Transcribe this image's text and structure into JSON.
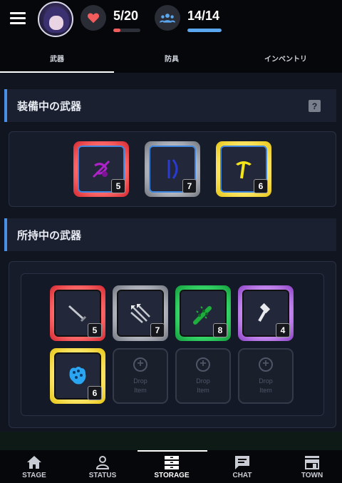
{
  "header": {
    "hp": {
      "text": "5/20",
      "fraction": 0.25,
      "color": "#f25c5c"
    },
    "team": {
      "text": "14/14",
      "fraction": 1.0,
      "color": "#5aa7ef"
    }
  },
  "tabs": [
    {
      "label": "武器",
      "active": true
    },
    {
      "label": "防具",
      "active": false
    },
    {
      "label": "インベントリ",
      "active": false
    }
  ],
  "equipped_section": {
    "title": "装備中の武器",
    "help": "?",
    "slots": [
      {
        "icon": "crossbow-icon",
        "rarity": "red",
        "level": "5"
      },
      {
        "icon": "bow-icon",
        "rarity": "silver",
        "level": "7"
      },
      {
        "icon": "pickaxe-icon",
        "rarity": "yellow",
        "level": "6"
      }
    ]
  },
  "owned_section": {
    "title": "所持中の武器",
    "items": [
      {
        "icon": "dagger-icon",
        "rarity": "red",
        "level": "5"
      },
      {
        "icon": "arrows-icon",
        "rarity": "silver",
        "level": "7"
      },
      {
        "icon": "spiked-club-icon",
        "rarity": "green",
        "level": "8"
      },
      {
        "icon": "hammer-icon",
        "rarity": "purple",
        "level": "4"
      },
      {
        "icon": "gauntlet-icon",
        "rarity": "yellow",
        "level": "6"
      }
    ],
    "empty_slot": {
      "line1": "Drop",
      "line2": "Item"
    }
  },
  "bottom_nav": [
    {
      "label": "STAGE",
      "icon": "home-icon"
    },
    {
      "label": "STATUS",
      "icon": "person-icon"
    },
    {
      "label": "STORAGE",
      "icon": "storage-icon",
      "active": true
    },
    {
      "label": "CHAT",
      "icon": "chat-icon"
    },
    {
      "label": "TOWN",
      "icon": "store-icon"
    }
  ]
}
